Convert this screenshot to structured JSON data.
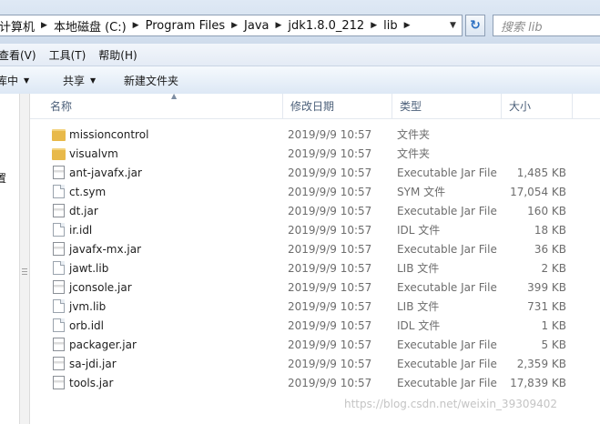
{
  "address": {
    "crumbs": [
      "计算机",
      "本地磁盘 (C:)",
      "Program Files",
      "Java",
      "jdk1.8.0_212",
      "lib"
    ]
  },
  "search": {
    "placeholder": "搜索 lib"
  },
  "menu": {
    "view": "查看(V)",
    "tools": "工具(T)",
    "help": "帮助(H)"
  },
  "commands": {
    "include_library": "库中",
    "share": "共享",
    "new_folder": "新建文件夹"
  },
  "nav": {
    "partial_label": "置"
  },
  "columns": {
    "name": "名称",
    "date": "修改日期",
    "type": "类型",
    "size": "大小"
  },
  "files": [
    {
      "name": "missioncontrol",
      "date": "2019/9/9 10:57",
      "type": "文件夹",
      "size": "",
      "icon": "folder"
    },
    {
      "name": "visualvm",
      "date": "2019/9/9 10:57",
      "type": "文件夹",
      "size": "",
      "icon": "folder"
    },
    {
      "name": "ant-javafx.jar",
      "date": "2019/9/9 10:57",
      "type": "Executable Jar File",
      "size": "1,485 KB",
      "icon": "jar"
    },
    {
      "name": "ct.sym",
      "date": "2019/9/9 10:57",
      "type": "SYM 文件",
      "size": "17,054 KB",
      "icon": "file"
    },
    {
      "name": "dt.jar",
      "date": "2019/9/9 10:57",
      "type": "Executable Jar File",
      "size": "160 KB",
      "icon": "jar"
    },
    {
      "name": "ir.idl",
      "date": "2019/9/9 10:57",
      "type": "IDL 文件",
      "size": "18 KB",
      "icon": "file"
    },
    {
      "name": "javafx-mx.jar",
      "date": "2019/9/9 10:57",
      "type": "Executable Jar File",
      "size": "36 KB",
      "icon": "jar"
    },
    {
      "name": "jawt.lib",
      "date": "2019/9/9 10:57",
      "type": "LIB 文件",
      "size": "2 KB",
      "icon": "file"
    },
    {
      "name": "jconsole.jar",
      "date": "2019/9/9 10:57",
      "type": "Executable Jar File",
      "size": "399 KB",
      "icon": "jar"
    },
    {
      "name": "jvm.lib",
      "date": "2019/9/9 10:57",
      "type": "LIB 文件",
      "size": "731 KB",
      "icon": "file"
    },
    {
      "name": "orb.idl",
      "date": "2019/9/9 10:57",
      "type": "IDL 文件",
      "size": "1 KB",
      "icon": "file"
    },
    {
      "name": "packager.jar",
      "date": "2019/9/9 10:57",
      "type": "Executable Jar File",
      "size": "5 KB",
      "icon": "jar"
    },
    {
      "name": "sa-jdi.jar",
      "date": "2019/9/9 10:57",
      "type": "Executable Jar File",
      "size": "2,359 KB",
      "icon": "jar"
    },
    {
      "name": "tools.jar",
      "date": "2019/9/9 10:57",
      "type": "Executable Jar File",
      "size": "17,839 KB",
      "icon": "jar"
    }
  ],
  "watermark": "https://blog.csdn.net/weixin_39309402"
}
